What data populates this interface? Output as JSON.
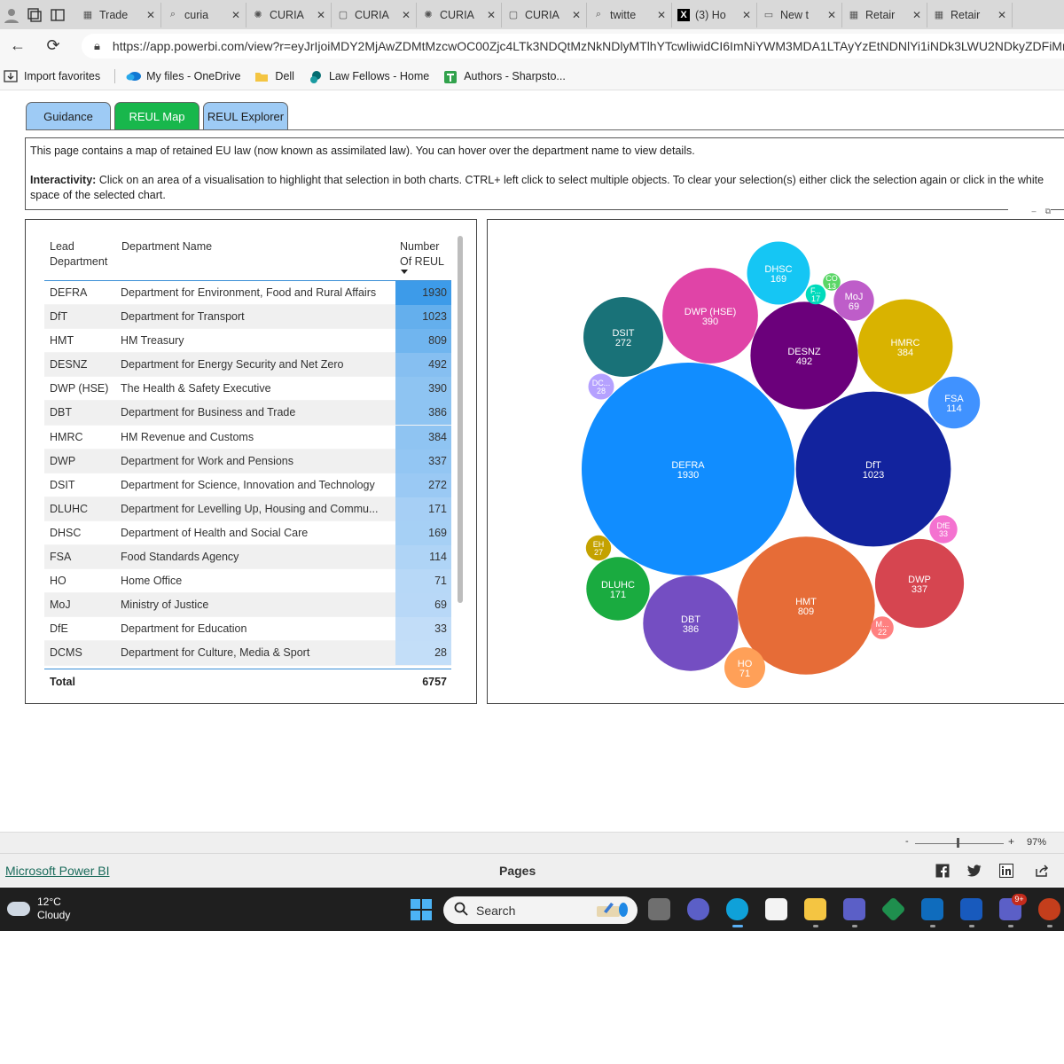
{
  "browser": {
    "tabs": [
      {
        "icon": "report-favicon",
        "label": "Trade"
      },
      {
        "icon": "search-favicon",
        "label": "curia"
      },
      {
        "icon": "curia-favicon",
        "label": "CURIA"
      },
      {
        "icon": "document-favicon",
        "label": "CURIA"
      },
      {
        "icon": "curia-favicon",
        "label": "CURIA"
      },
      {
        "icon": "document-favicon",
        "label": "CURIA"
      },
      {
        "icon": "search-favicon",
        "label": "twitte"
      },
      {
        "icon": "x-favicon",
        "label": "(3) Ho"
      },
      {
        "icon": "newtab-favicon",
        "label": "New t"
      },
      {
        "icon": "report-favicon",
        "label": "Retair"
      },
      {
        "icon": "report-favicon",
        "label": "Retair"
      }
    ],
    "url": "https://app.powerbi.com/view?r=eyJrIjoiMDY2MjAwZDMtMzcwOC00Zjc4LTk3NDQtMzNkNDlyMTlhYTcwliwidCI6ImNiYWM3MDA1LTAyYzEtNDNlYi1iNDk3LWU2NDkyZDFiMr",
    "favorites": [
      {
        "icon": "import-icon",
        "label": "Import favorites"
      },
      {
        "icon": "onedrive-icon",
        "label": "My files - OneDrive"
      },
      {
        "icon": "folder-icon",
        "label": "Dell"
      },
      {
        "icon": "sharepoint-icon",
        "label": "Law Fellows - Home"
      },
      {
        "icon": "planner-icon",
        "label": "Authors - Sharpsto..."
      }
    ]
  },
  "report": {
    "nav_tabs": {
      "guidance": "Guidance",
      "reul_map": "REUL Map",
      "reul_explorer": "REUL Explorer"
    },
    "info": {
      "line1": "This page contains a map of retained EU law (now known as assimilated law). You can hover over the department name to view details.",
      "interactivity_label": "Interactivity:",
      "interactivity_text": " Click on an area of a visualisation to highlight that selection in both charts. CTRL+ left click to select multiple objects. To clear your selection(s) either click the selection again or click in the white space of the selected chart."
    },
    "table": {
      "headers": {
        "lead": "Lead Department",
        "name": "Department Name",
        "count": "Number Of REUL"
      },
      "rows": [
        {
          "lead": "DEFRA",
          "name": "Department for Environment, Food and Rural Affairs",
          "count": 1930
        },
        {
          "lead": "DfT",
          "name": "Department for Transport",
          "count": 1023
        },
        {
          "lead": "HMT",
          "name": "HM Treasury",
          "count": 809
        },
        {
          "lead": "DESNZ",
          "name": "Department for Energy Security and Net Zero",
          "count": 492
        },
        {
          "lead": "DWP (HSE)",
          "name": "The Health & Safety Executive",
          "count": 390
        },
        {
          "lead": "DBT",
          "name": "Department for Business and Trade",
          "count": 386
        },
        {
          "lead": "HMRC",
          "name": "HM Revenue and Customs",
          "count": 384
        },
        {
          "lead": "DWP",
          "name": "Department for Work and Pensions",
          "count": 337
        },
        {
          "lead": "DSIT",
          "name": "Department for Science, Innovation and Technology",
          "count": 272
        },
        {
          "lead": "DLUHC",
          "name": "Department for Levelling Up, Housing and Commu...",
          "count": 171
        },
        {
          "lead": "DHSC",
          "name": "Department of Health and Social Care",
          "count": 169
        },
        {
          "lead": "FSA",
          "name": "Food Standards Agency",
          "count": 114
        },
        {
          "lead": "HO",
          "name": "Home Office",
          "count": 71
        },
        {
          "lead": "MoJ",
          "name": "Ministry of Justice",
          "count": 69
        },
        {
          "lead": "DfE",
          "name": "Department for Education",
          "count": 33
        },
        {
          "lead": "DCMS",
          "name": "Department for Culture, Media & Sport",
          "count": 28
        }
      ],
      "total_label": "Total",
      "total_value": "6757",
      "bar_color_max": "#3d9be9",
      "bar_color_min": "#dbeafb"
    }
  },
  "chart_data": {
    "type": "bubble",
    "bubbles": [
      {
        "label": "DEFRA",
        "value": 1930,
        "color": "#118dff"
      },
      {
        "label": "DfT",
        "value": 1023,
        "color": "#12239e"
      },
      {
        "label": "HMT",
        "value": 809,
        "color": "#e66c37"
      },
      {
        "label": "DESNZ",
        "value": 492,
        "color": "#6b007b"
      },
      {
        "label": "DWP (HSE)",
        "value": 390,
        "color": "#e044a7"
      },
      {
        "label": "DBT",
        "value": 386,
        "color": "#744ec2"
      },
      {
        "label": "HMRC",
        "value": 384,
        "color": "#d9b300"
      },
      {
        "label": "DWP",
        "value": 337,
        "color": "#d64550"
      },
      {
        "label": "DSIT",
        "value": 272,
        "color": "#197278"
      },
      {
        "label": "DLUHC",
        "value": 171,
        "color": "#1aab40"
      },
      {
        "label": "DHSC",
        "value": 169,
        "color": "#15c6f4"
      },
      {
        "label": "FSA",
        "value": 114,
        "color": "#4092ff"
      },
      {
        "label": "HO",
        "value": 71,
        "color": "#ffa058"
      },
      {
        "label": "MoJ",
        "value": 69,
        "color": "#be5dc9"
      },
      {
        "label": "DfE",
        "value": 33,
        "color": "#f472d0"
      },
      {
        "label": "DC...",
        "value": 28,
        "color": "#b5a1ff"
      },
      {
        "label": "EH",
        "value": 27,
        "color": "#c4a200"
      },
      {
        "label": "M...",
        "value": 22,
        "color": "#ff8080"
      },
      {
        "label": "F...",
        "value": 17,
        "color": "#00dbbc"
      },
      {
        "label": "CO",
        "value": 13,
        "color": "#5bd667"
      }
    ]
  },
  "status": {
    "zoom_minus": "-",
    "zoom_plus": "+",
    "zoom_level": "97%",
    "zoom_fraction": 0.47,
    "powerbi_link": "Microsoft Power BI",
    "pages_label": "Pages"
  },
  "taskbar": {
    "temperature": "12°C",
    "condition": "Cloudy",
    "search_placeholder": "Search",
    "teams_badge": "9+"
  }
}
